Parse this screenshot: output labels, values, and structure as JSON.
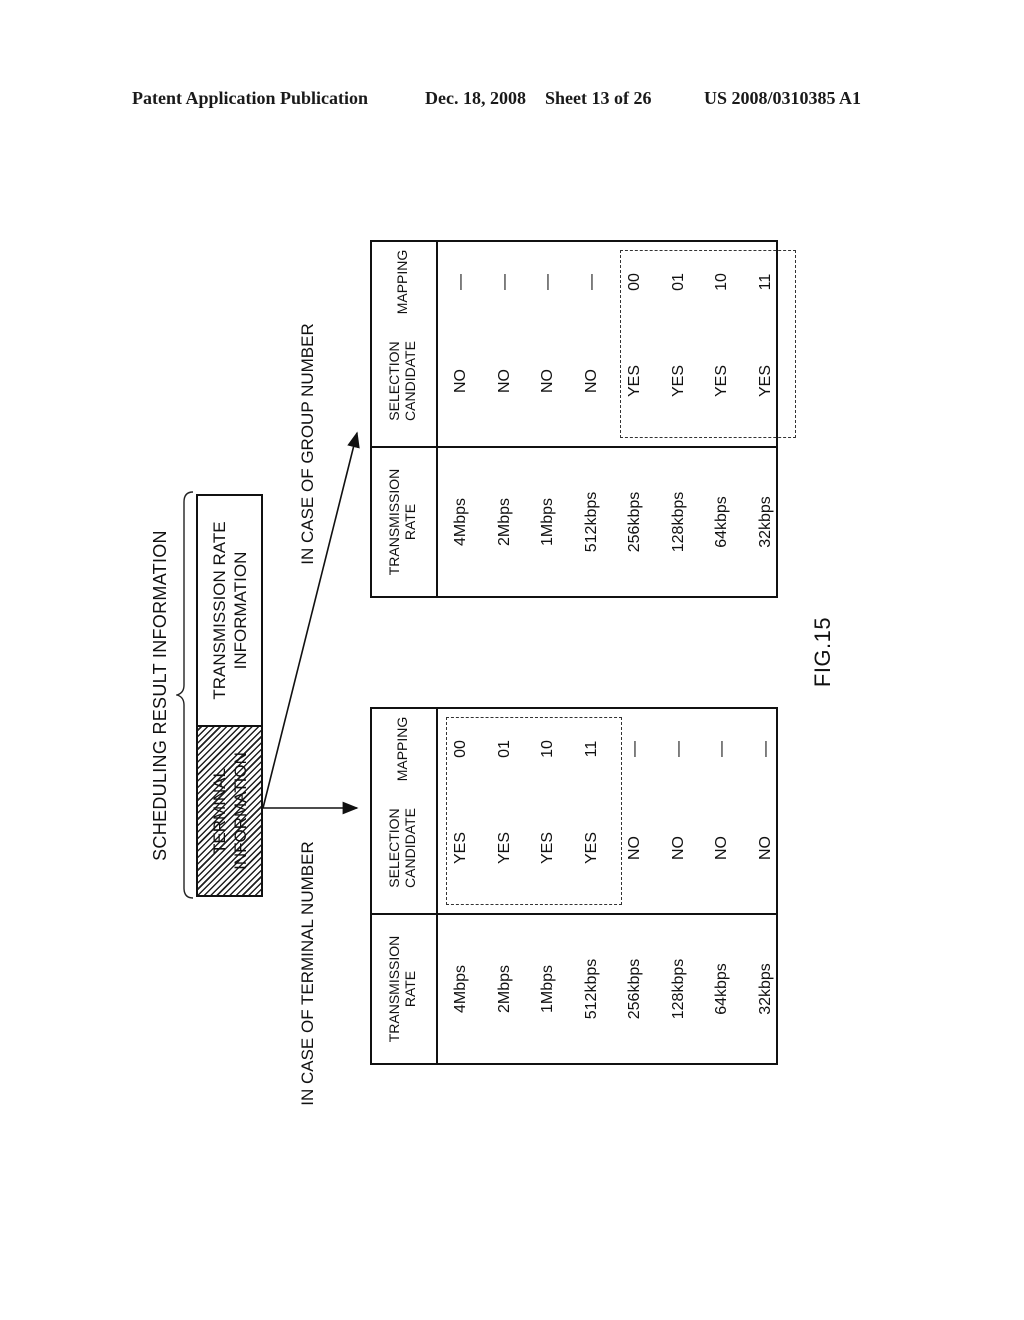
{
  "header": {
    "publication": "Patent Application Publication",
    "date": "Dec. 18, 2008",
    "sheet": "Sheet 13 of 26",
    "patent_number": "US 2008/0310385 A1"
  },
  "figure": {
    "label": "FIG.15",
    "scheduling_title": "SCHEDULING RESULT INFORMATION",
    "fields": {
      "terminal_line1": "TERMINAL",
      "terminal_line2": "INFORMATION",
      "rate_line1": "TRANSMISSION RATE",
      "rate_line2": "INFORMATION"
    },
    "case_terminal": "IN CASE OF TERMINAL NUMBER",
    "case_group": "IN CASE OF GROUP NUMBER",
    "table_headers": {
      "rate_line1": "TRANSMISSION",
      "rate_line2": "RATE",
      "candidate_line1": "SELECTION",
      "candidate_line2": "CANDIDATE",
      "mapping": "MAPPING"
    },
    "tables": [
      {
        "name": "terminal-number-table",
        "rows": [
          {
            "rate": "4Mbps",
            "candidate": "YES",
            "mapping": "00"
          },
          {
            "rate": "2Mbps",
            "candidate": "YES",
            "mapping": "01"
          },
          {
            "rate": "1Mbps",
            "candidate": "YES",
            "mapping": "10"
          },
          {
            "rate": "512kbps",
            "candidate": "YES",
            "mapping": "11"
          },
          {
            "rate": "256kbps",
            "candidate": "NO",
            "mapping": "—"
          },
          {
            "rate": "128kbps",
            "candidate": "NO",
            "mapping": "—"
          },
          {
            "rate": "64kbps",
            "candidate": "NO",
            "mapping": "—"
          },
          {
            "rate": "32kbps",
            "candidate": "NO",
            "mapping": "—"
          }
        ]
      },
      {
        "name": "group-number-table",
        "rows": [
          {
            "rate": "4Mbps",
            "candidate": "NO",
            "mapping": "—"
          },
          {
            "rate": "2Mbps",
            "candidate": "NO",
            "mapping": "—"
          },
          {
            "rate": "1Mbps",
            "candidate": "NO",
            "mapping": "—"
          },
          {
            "rate": "512kbps",
            "candidate": "NO",
            "mapping": "—"
          },
          {
            "rate": "256kbps",
            "candidate": "YES",
            "mapping": "00"
          },
          {
            "rate": "128kbps",
            "candidate": "YES",
            "mapping": "01"
          },
          {
            "rate": "64kbps",
            "candidate": "YES",
            "mapping": "10"
          },
          {
            "rate": "32kbps",
            "candidate": "YES",
            "mapping": "11"
          }
        ]
      }
    ]
  }
}
